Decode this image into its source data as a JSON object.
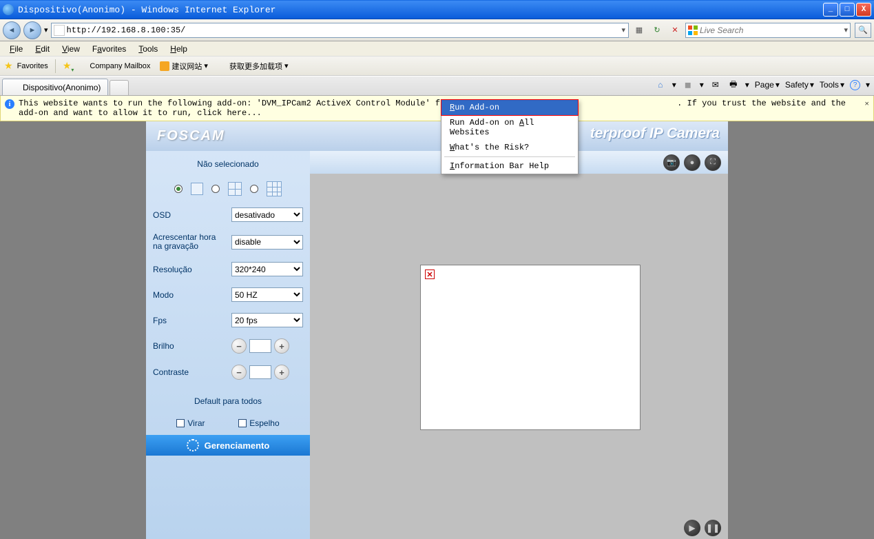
{
  "window": {
    "title": "Dispositivo(Anonimo) - Windows Internet Explorer"
  },
  "nav": {
    "url": "http://192.168.8.100:35/",
    "search_placeholder": "Live Search"
  },
  "menus": {
    "file": "File",
    "edit": "Edit",
    "view": "View",
    "favorites": "Favorites",
    "tools": "Tools",
    "help": "Help"
  },
  "favbar": {
    "favorites_label": "Favorites",
    "company_mailbox": "Company Mailbox",
    "suggested": "建议网站",
    "more": "获取更多加载项"
  },
  "tab": {
    "title": "Dispositivo(Anonimo)"
  },
  "tabtools": {
    "page": "Page",
    "safety": "Safety",
    "tools": "Tools"
  },
  "infobar": {
    "text_before": "This website wants to run the following add-on: 'DVM_IPCam2 ActiveX Control Module' from 'ShenZhen Fosc",
    "text_after": ". If you trust the website and the add-on and want to allow it to run, click here..."
  },
  "contextmenu": {
    "run": "Run Add-on",
    "run_all": "Run Add-on on All Websites",
    "risk": "What's the Risk?",
    "info": "Information Bar Help"
  },
  "camera": {
    "logo": "FOSCAM",
    "header_title": "terproof IP Camera",
    "sidebar_title": "Não selecionado",
    "osd_label": "OSD",
    "osd_value": "desativado",
    "timestamp_label": "Acrescentar hora na gravação",
    "timestamp_value": "disable",
    "resolution_label": "Resolução",
    "resolution_value": "320*240",
    "mode_label": "Modo",
    "mode_value": "50 HZ",
    "fps_label": "Fps",
    "fps_value": "20 fps",
    "brightness_label": "Brilho",
    "brightness_value": "",
    "contrast_label": "Contraste",
    "contrast_value": "",
    "default_label": "Default para todos",
    "flip_label": "Virar",
    "mirror_label": "Espelho",
    "footer_label": "Gerenciamento"
  }
}
